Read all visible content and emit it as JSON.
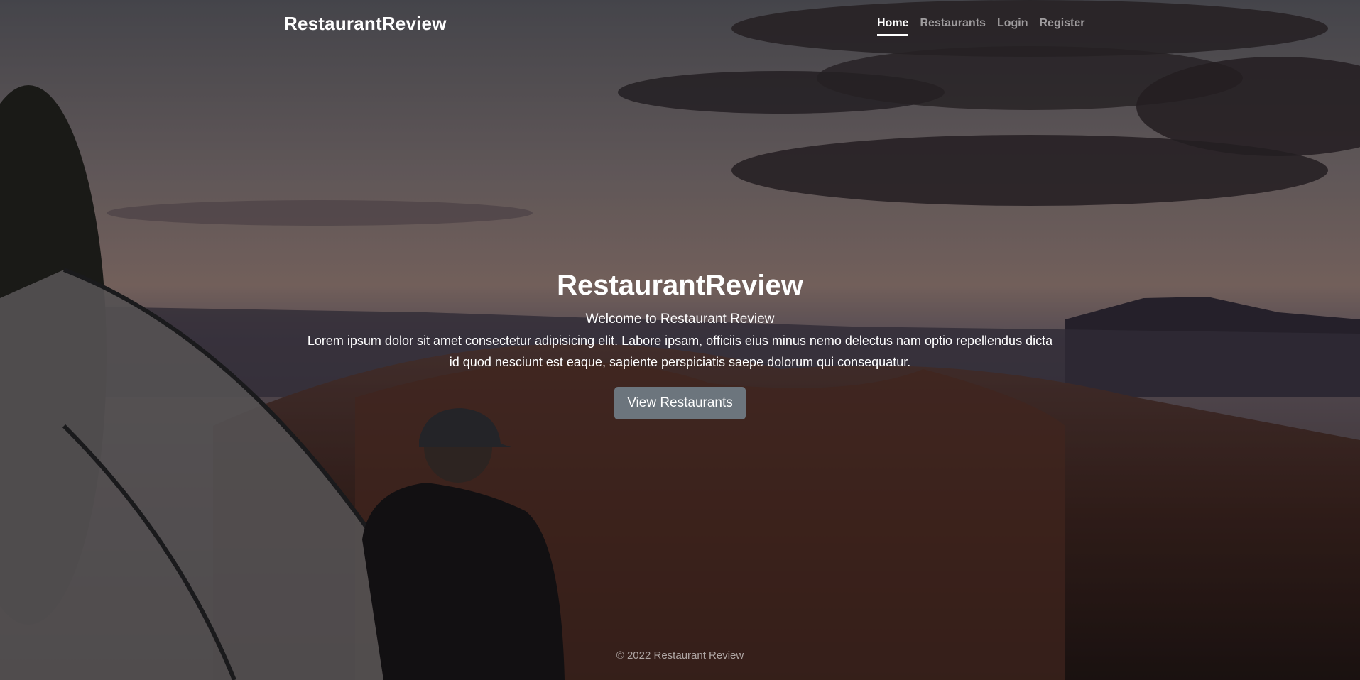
{
  "nav": {
    "brand": "RestaurantReview",
    "links": [
      {
        "label": "Home",
        "active": true
      },
      {
        "label": "Restaurants",
        "active": false
      },
      {
        "label": "Login",
        "active": false
      },
      {
        "label": "Register",
        "active": false
      }
    ]
  },
  "hero": {
    "title": "RestaurantReview",
    "subtitle": "Welcome to Restaurant Review",
    "text": "Lorem ipsum dolor sit amet consectetur adipisicing elit. Labore ipsam, officiis eius minus nemo delectus nam optio repellendus dicta id quod nesciunt est eaque, sapiente perspiciatis saepe dolorum qui consequatur.",
    "button_label": "View Restaurants"
  },
  "footer": {
    "text": "© 2022 Restaurant Review"
  },
  "colors": {
    "button_bg": "#6c757d",
    "text": "#ffffff"
  }
}
